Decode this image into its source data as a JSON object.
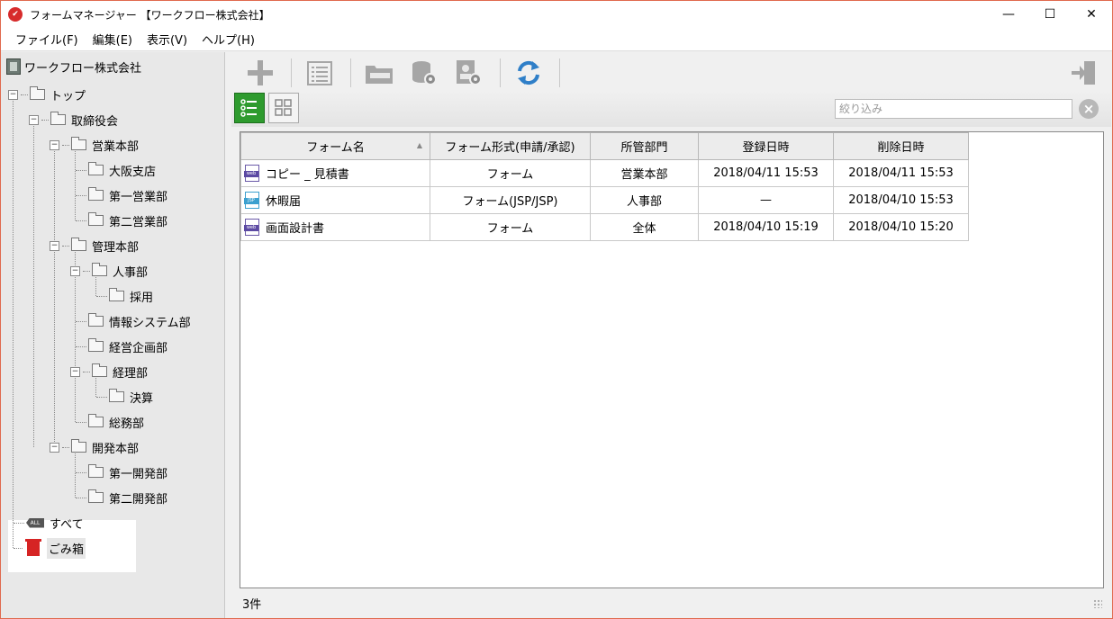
{
  "window": {
    "title": "フォームマネージャー 【ワークフロー株式会社】",
    "minimize": "—",
    "maximize": "☐",
    "close": "✕"
  },
  "menu": [
    {
      "label": "ファイル(F)"
    },
    {
      "label": "編集(E)"
    },
    {
      "label": "表示(V)"
    },
    {
      "label": "ヘルプ(H)"
    }
  ],
  "sidebar": {
    "company": "ワークフロー株式会社",
    "tree": [
      {
        "label": "トップ",
        "toggle": "−"
      },
      {
        "label": "取締役会",
        "toggle": "−"
      },
      {
        "label": "営業本部",
        "toggle": "−"
      },
      {
        "label": "大阪支店"
      },
      {
        "label": "第一営業部"
      },
      {
        "label": "第二営業部"
      },
      {
        "label": "管理本部",
        "toggle": "−"
      },
      {
        "label": "人事部",
        "toggle": "−"
      },
      {
        "label": "採用"
      },
      {
        "label": "情報システム部"
      },
      {
        "label": "経営企画部"
      },
      {
        "label": "経理部",
        "toggle": "−"
      },
      {
        "label": "決算"
      },
      {
        "label": "総務部"
      },
      {
        "label": "開発本部",
        "toggle": "−"
      },
      {
        "label": "第一開発部"
      },
      {
        "label": "第二開発部"
      }
    ],
    "all_label": "すべて",
    "all_badge": "ALL",
    "trash_label": "ごみ箱"
  },
  "toolbar": {
    "icons": [
      "plus-icon",
      "list-icon",
      "js-css-folder-icon",
      "database-settings-icon",
      "user-settings-icon",
      "refresh-icon",
      "exit-icon"
    ],
    "colors": {
      "icon_gray": "#a6a6a6",
      "refresh": "#2f7fc8",
      "list_view_active": "#2e9b2e"
    }
  },
  "filter": {
    "placeholder": "絞り込み",
    "value": ""
  },
  "table": {
    "columns": [
      "フォーム名",
      "フォーム形式(申請/承認)",
      "所管部門",
      "登録日時",
      "削除日時"
    ],
    "rows": [
      {
        "icon": "web",
        "icon_label": "web",
        "name": "コピー _ 見積書",
        "type": "フォーム",
        "dept": "営業本部",
        "registered": "2018/04/11 15:53",
        "deleted": "2018/04/11 15:53"
      },
      {
        "icon": "jsp",
        "icon_label": "JSP",
        "name": "休暇届",
        "type": "フォーム(JSP/JSP)",
        "dept": "人事部",
        "registered": "—",
        "deleted": "2018/04/10 15:53"
      },
      {
        "icon": "web",
        "icon_label": "web",
        "name": "画面設計書",
        "type": "フォーム",
        "dept": "全体",
        "registered": "2018/04/10 15:19",
        "deleted": "2018/04/10 15:20"
      }
    ]
  },
  "status": {
    "count": "3件"
  }
}
